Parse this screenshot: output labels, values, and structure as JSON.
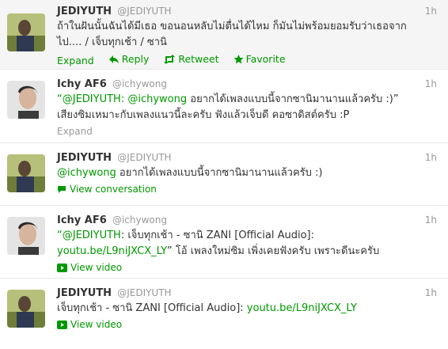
{
  "tweets": [
    {
      "name": "JEDIYUTH",
      "handle": "@JEDIYUTH",
      "time": "1h",
      "line1": "ถ้าในฝันนั้นฉันได้มีเธอ ขอนอนหลับไม่ตื่นได้ไหม ก็มันไม่พร้อมยอมรับว่าเธอจาก",
      "line2": "ไป.... / เจ็บทุกเช้า / ซานิ",
      "actions": {
        "expand": "Expand",
        "reply": "Reply",
        "retweet": "Retweet",
        "favorite": "Favorite"
      }
    },
    {
      "name": "Ichy AF6",
      "handle": "@ichywong",
      "time": "1h",
      "quote_open": "“",
      "mention1": "@JEDIYUTH",
      "colon": ":",
      "mention2": "@ichywong",
      "rest1": "อยากได้เพลงแบบนี้จากซานิมานานแล้วครับ :)”",
      "line2": "เสียงซิมเหมาะกับเพลงแนวนี้ละครับ ฟังแล้วเจ็บดี คอซาดิสต์ครับ :P",
      "expand": "Expand"
    },
    {
      "name": "JEDIYUTH",
      "handle": "@JEDIYUTH",
      "time": "1h",
      "mention": "@ichywong",
      "rest": "อยากได้เพลงแบบนี้จากซานิมานานแล้วครับ :)",
      "meta": "View conversation"
    },
    {
      "name": "Ichy AF6",
      "handle": "@ichywong",
      "time": "1h",
      "quote_open": "“",
      "mention": "@JEDIYUTH",
      "rest1": ": เจ็บทุกเช้า - ซานิ ZANI [Official Audio]:",
      "link": "youtu.be/L9niJXCX_LY",
      "rest2": "” โอ้ เพลงใหม่ซิม เพิ่งเคยฟังครับ เพราะดีนะครับ",
      "meta": "View video"
    },
    {
      "name": "JEDIYUTH",
      "handle": "@JEDIYUTH",
      "time": "1h",
      "rest": "เจ็บทุกเช้า - ซานิ ZANI [Official Audio]:",
      "link": "youtu.be/L9niJXCX_LY",
      "meta": "View video"
    }
  ],
  "colors": {
    "accent": "#009900",
    "muted": "#999999",
    "text": "#333333"
  }
}
